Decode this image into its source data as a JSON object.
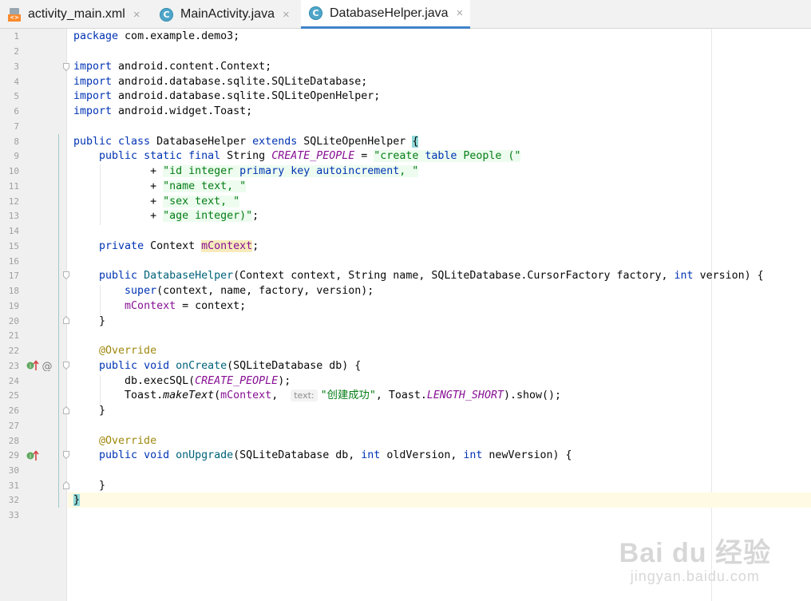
{
  "tabs": [
    {
      "label": "activity_main.xml",
      "icon": "xml-file-icon",
      "active": false
    },
    {
      "label": "MainActivity.java",
      "icon": "java-class-icon",
      "active": false
    },
    {
      "label": "DatabaseHelper.java",
      "icon": "java-class-icon",
      "active": true
    }
  ],
  "tab_close_glyph": "×",
  "class_icon_letter": "C",
  "xml_icon_text": "<>",
  "line_numbers": [
    "1",
    "2",
    "3",
    "4",
    "5",
    "6",
    "7",
    "8",
    "9",
    "10",
    "11",
    "12",
    "13",
    "14",
    "15",
    "16",
    "17",
    "18",
    "19",
    "20",
    "21",
    "22",
    "23",
    "24",
    "25",
    "26",
    "27",
    "28",
    "29",
    "30",
    "31",
    "32",
    "33"
  ],
  "code": {
    "l1": "package com.example.demo3;",
    "l3": "import android.content.Context;",
    "l4": "import android.database.sqlite.SQLiteDatabase;",
    "l5": "import android.database.sqlite.SQLiteOpenHelper;",
    "l6": "import android.widget.Toast;",
    "l8": "public class DatabaseHelper extends SQLiteOpenHelper {",
    "l9": "    public static final String CREATE_PEOPLE = \"create table People (\"",
    "l10": "            + \"id integer primary key autoincrement, \"",
    "l11": "            + \"name text, \"",
    "l12": "            + \"sex text, \"",
    "l13": "            + \"age integer)\";",
    "l15": "    private Context mContext;",
    "l17": "    public DatabaseHelper(Context context, String name, SQLiteDatabase.CursorFactory factory, int version) {",
    "l18": "        super(context, name, factory, version);",
    "l19": "        mContext = context;",
    "l20": "    }",
    "l22": "    @Override",
    "l23": "    public void onCreate(SQLiteDatabase db) {",
    "l24": "        db.execSQL(CREATE_PEOPLE);",
    "l25a": "        Toast.makeText(mContext,",
    "l25hint": "text:",
    "l25b": "\"创建成功\", Toast.LENGTH_SHORT).show();",
    "l26": "    }",
    "l28": "    @Override",
    "l29": "    public void onUpgrade(SQLiteDatabase db, int oldVersion, int newVersion) {",
    "l31": "    }",
    "l32": "}"
  },
  "watermark": {
    "brand": "Bai  du 经验",
    "url": "jingyan.baidu.com"
  }
}
